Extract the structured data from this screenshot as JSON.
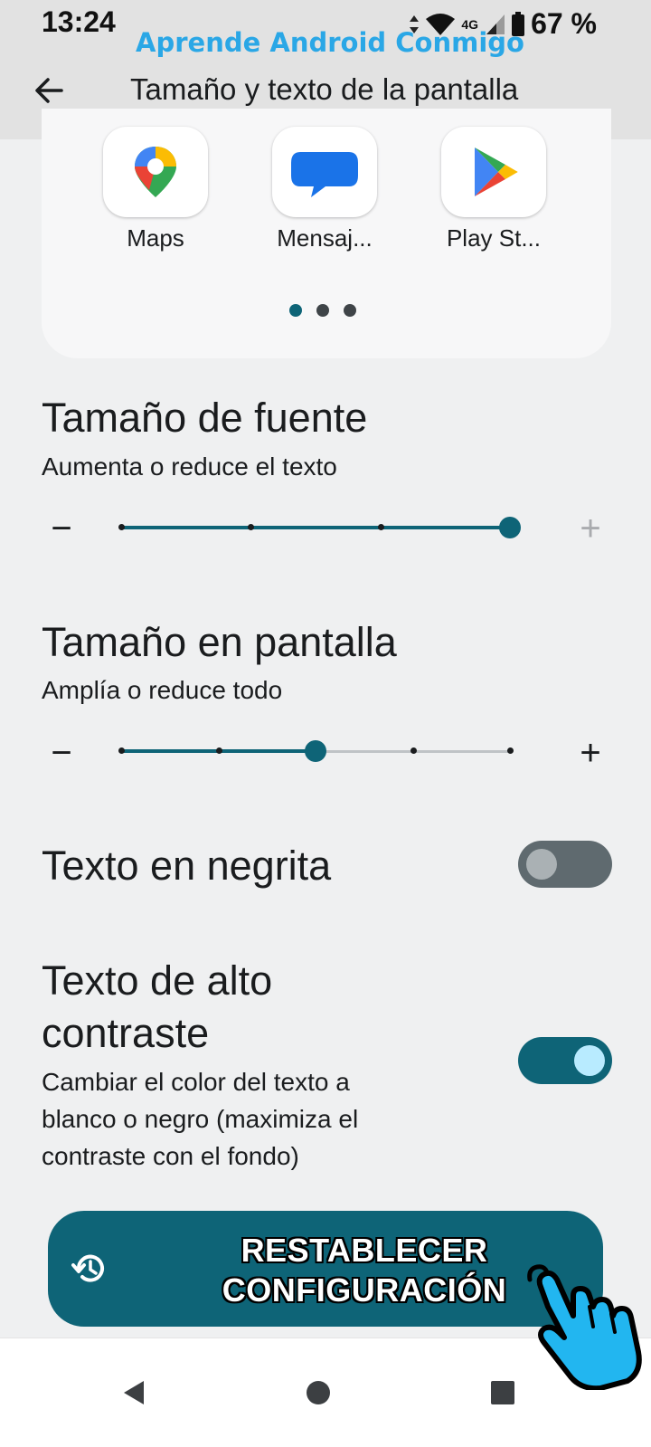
{
  "status_bar": {
    "time": "13:24",
    "network": "4G",
    "battery": "67 %"
  },
  "watermark": "Aprende Android Conmigo",
  "header": {
    "title": "Tamaño y texto de la pantalla"
  },
  "preview": {
    "apps": [
      {
        "label": "Maps",
        "icon": "maps-icon"
      },
      {
        "label": "Mensaj...",
        "icon": "messages-icon"
      },
      {
        "label": "Play St...",
        "icon": "play-store-icon"
      }
    ],
    "page_indicator": {
      "pages": 3,
      "active": 1
    }
  },
  "font_size": {
    "title": "Tamaño de fuente",
    "subtitle": "Aumenta o reduce el texto",
    "steps": 4,
    "value": 4,
    "minus": "−",
    "plus": "+"
  },
  "display_size": {
    "title": "Tamaño en pantalla",
    "subtitle": "Amplía o reduce todo",
    "steps": 5,
    "value": 3,
    "minus": "−",
    "plus": "+"
  },
  "bold_text": {
    "title": "Texto en negrita",
    "enabled": false
  },
  "high_contrast": {
    "title_line1": "Texto de alto",
    "title_line2": "contraste",
    "description_lines": [
      "Cambiar el color del texto a",
      "blanco o negro (maximiza el",
      "contraste con el fondo)"
    ],
    "enabled": true
  },
  "reset_button": {
    "line1": "RESTABLECER",
    "line2": "CONFIGURACIÓN",
    "icon": "history-icon"
  },
  "nav": {
    "back": "back-icon",
    "home": "home-icon",
    "recents": "recents-icon"
  },
  "colors": {
    "accent": "#0e6477",
    "watermark": "#2aa7e6",
    "toggle_off": "#5f6a6f",
    "toggle_on_knob": "#b8ebff"
  }
}
